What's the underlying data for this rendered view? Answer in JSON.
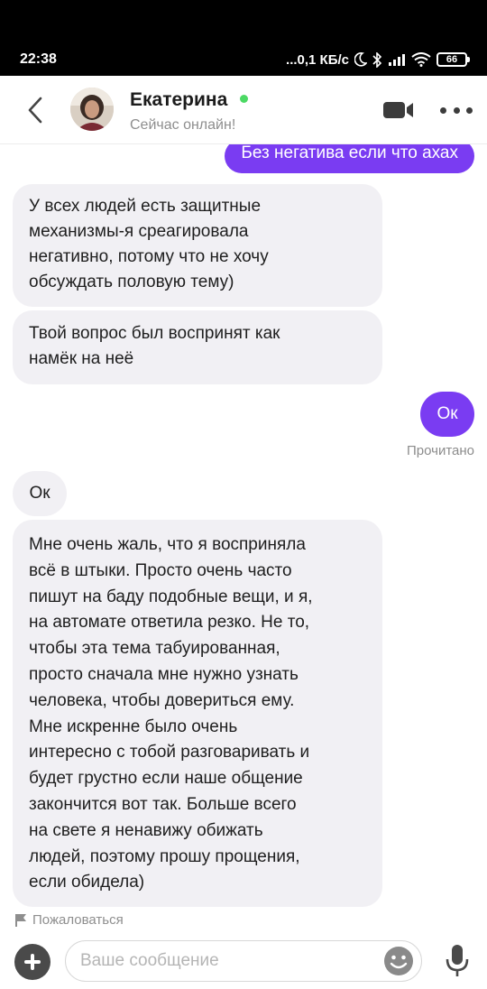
{
  "status_bar": {
    "time": "22:38",
    "net_speed": "...0,1 КБ/с",
    "battery": "66"
  },
  "header": {
    "contact_name": "Екатерина",
    "contact_status": "Сейчас онлайн!",
    "icons": {
      "back": "chevron-left-icon",
      "video": "video-camera-icon",
      "more": "more-dots-icon"
    }
  },
  "messages": [
    {
      "direction": "out",
      "text": "Без негатива если что ахах"
    },
    {
      "direction": "in",
      "lines": [
        "У всех людей есть защитные",
        "механизмы-я среагировала",
        "негативно, потому что не хочу",
        "обсуждать половую тему)"
      ]
    },
    {
      "direction": "in",
      "lines": [
        "Твой вопрос был воспринят как",
        "намёк на неё"
      ]
    },
    {
      "direction": "out",
      "text": "Ок"
    },
    {
      "direction": "in",
      "text": "Ок"
    },
    {
      "direction": "in",
      "lines": [
        "Мне очень жаль, что я восприняла",
        "всё в штыки. Просто очень часто",
        "пишут на баду подобные вещи, и я,",
        "на автомате ответила резко. Не то,",
        "чтобы эта тема табуированная,",
        "просто сначала мне нужно узнать",
        "человека, чтобы довериться ему.",
        "Мне искренне было очень",
        "интересно с тобой разговаривать и",
        "будет грустно если наше общение",
        "закончится вот так. Больше всего",
        "на свете я ненавижу обижать",
        "людей, поэтому прошу прощения,",
        "если обидела)"
      ]
    }
  ],
  "read_receipt": "Прочитано",
  "report_label": "Пожаловаться",
  "composer": {
    "placeholder": "Ваше сообщение",
    "value": ""
  },
  "colors": {
    "accent": "#7a3cf2",
    "incoming_bubble": "#f1f0f4",
    "online": "#4cd964"
  }
}
